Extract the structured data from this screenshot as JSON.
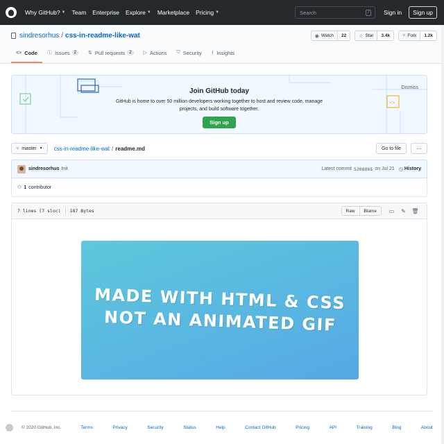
{
  "topnav": {
    "items": [
      {
        "label": "Why GitHub?",
        "has_caret": true
      },
      {
        "label": "Team",
        "has_caret": false
      },
      {
        "label": "Enterprise",
        "has_caret": false
      },
      {
        "label": "Explore",
        "has_caret": true
      },
      {
        "label": "Marketplace",
        "has_caret": false
      },
      {
        "label": "Pricing",
        "has_caret": true
      }
    ],
    "search_placeholder": "Search",
    "search_shortcut": "/",
    "sign_in": "Sign in",
    "sign_up": "Sign up"
  },
  "repo": {
    "owner": "sindresorhus",
    "separator": "/",
    "name": "css-in-readme-like-wat",
    "watch_label": "Watch",
    "watch_count": "22",
    "star_label": "Star",
    "star_count": "3.4k",
    "fork_label": "Fork",
    "fork_count": "1.2k"
  },
  "tabs": [
    {
      "label": "Code",
      "icon": "code-icon",
      "counter": "",
      "active": true
    },
    {
      "label": "Issues",
      "icon": "issue-icon",
      "counter": "2",
      "active": false
    },
    {
      "label": "Pull requests",
      "icon": "pull-request-icon",
      "counter": "2",
      "active": false
    },
    {
      "label": "Actions",
      "icon": "play-icon",
      "counter": "",
      "active": false
    },
    {
      "label": "Security",
      "icon": "shield-icon",
      "counter": "",
      "active": false
    },
    {
      "label": "Insights",
      "icon": "graph-icon",
      "counter": "",
      "active": false
    }
  ],
  "banner": {
    "title": "Join GitHub today",
    "text": "GitHub is home to over 50 million developers working together to host and review code, manage projects, and build software together.",
    "button": "Sign up",
    "dismiss": "Dismiss"
  },
  "filenav": {
    "branch": "master",
    "repo_link": "css-in-readme-like-wat",
    "separator": "/",
    "file": "readme.md",
    "go_to_file": "Go to file",
    "more": "···"
  },
  "commit": {
    "author": "sindresorhus",
    "message": "Init",
    "latest_label": "Latest commit",
    "sha": "5200865",
    "date": "on Jul 21",
    "history": "History"
  },
  "contributors": {
    "count": "1",
    "label": "contributor"
  },
  "file": {
    "lines": "7 lines (7 sloc)",
    "size": "187 Bytes",
    "raw": "Raw",
    "blame": "Blame",
    "hero_line1": "MADE WITH HTML & CSS",
    "hero_line2": "NOT AN ANIMATED GIF"
  },
  "footer": {
    "copyright": "© 2020 GitHub, Inc.",
    "links": [
      "Terms",
      "Privacy",
      "Security",
      "Status",
      "Help",
      "Contact GitHub",
      "Pricing",
      "API",
      "Training",
      "Blog",
      "About"
    ]
  },
  "colors": {
    "nav_bg": "#24292e",
    "link": "#0366d6",
    "green": "#2ea44f",
    "tab_underline": "#f9826c",
    "hero_start": "#5ec8dc",
    "hero_end": "#55a8e4"
  }
}
